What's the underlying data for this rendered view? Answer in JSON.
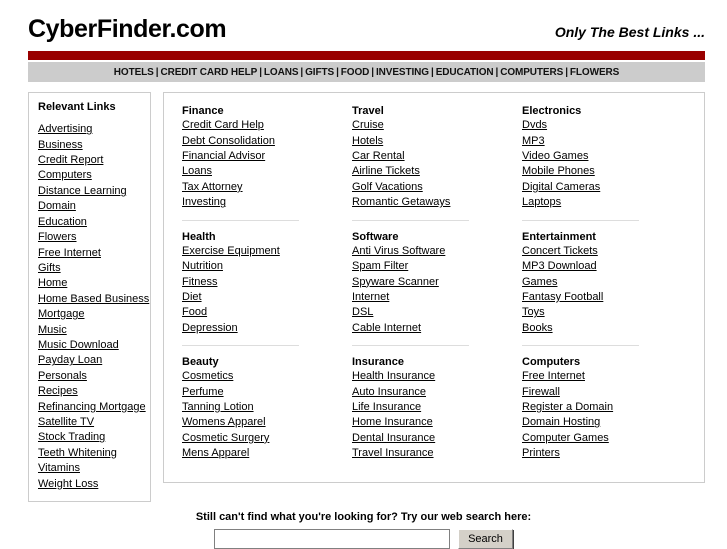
{
  "header": {
    "logo": "CyberFinder.com",
    "tagline": "Only The Best Links ..."
  },
  "topnav": {
    "separator": "|",
    "items": [
      {
        "label": "HOTELS"
      },
      {
        "label": "CREDIT CARD HELP"
      },
      {
        "label": "LOANS"
      },
      {
        "label": "GIFTS"
      },
      {
        "label": "FOOD"
      },
      {
        "label": "INVESTING"
      },
      {
        "label": "EDUCATION"
      },
      {
        "label": "COMPUTERS"
      },
      {
        "label": "FLOWERS"
      }
    ]
  },
  "sidebar": {
    "title": "Relevant Links",
    "items": [
      {
        "label": "Advertising"
      },
      {
        "label": "Business"
      },
      {
        "label": "Credit Report"
      },
      {
        "label": "Computers"
      },
      {
        "label": "Distance Learning"
      },
      {
        "label": "Domain"
      },
      {
        "label": "Education"
      },
      {
        "label": "Flowers"
      },
      {
        "label": "Free Internet"
      },
      {
        "label": "Gifts"
      },
      {
        "label": "Home"
      },
      {
        "label": "Home Based Business"
      },
      {
        "label": "Mortgage"
      },
      {
        "label": "Music"
      },
      {
        "label": "Music Download"
      },
      {
        "label": "Payday Loan"
      },
      {
        "label": "Personals"
      },
      {
        "label": "Recipes"
      },
      {
        "label": "Refinancing Mortgage"
      },
      {
        "label": "Satellite TV"
      },
      {
        "label": "Stock Trading"
      },
      {
        "label": "Teeth Whitening"
      },
      {
        "label": "Vitamins"
      },
      {
        "label": "Weight Loss"
      }
    ]
  },
  "main": {
    "columns": [
      {
        "groups": [
          {
            "title": "Finance",
            "links": [
              {
                "label": "Credit Card Help"
              },
              {
                "label": "Debt Consolidation"
              },
              {
                "label": "Financial Advisor"
              },
              {
                "label": "Loans"
              },
              {
                "label": "Tax Attorney"
              },
              {
                "label": "Investing"
              }
            ]
          },
          {
            "title": "Health",
            "links": [
              {
                "label": "Exercise Equipment"
              },
              {
                "label": "Nutrition"
              },
              {
                "label": "Fitness"
              },
              {
                "label": "Diet"
              },
              {
                "label": "Food"
              },
              {
                "label": "Depression"
              }
            ]
          },
          {
            "title": "Beauty",
            "links": [
              {
                "label": "Cosmetics"
              },
              {
                "label": "Perfume"
              },
              {
                "label": "Tanning Lotion"
              },
              {
                "label": "Womens Apparel"
              },
              {
                "label": "Cosmetic Surgery"
              },
              {
                "label": "Mens Apparel"
              }
            ]
          }
        ]
      },
      {
        "groups": [
          {
            "title": "Travel",
            "links": [
              {
                "label": "Cruise"
              },
              {
                "label": "Hotels"
              },
              {
                "label": "Car Rental"
              },
              {
                "label": "Airline Tickets"
              },
              {
                "label": "Golf Vacations"
              },
              {
                "label": "Romantic Getaways"
              }
            ]
          },
          {
            "title": "Software",
            "links": [
              {
                "label": "Anti Virus Software"
              },
              {
                "label": "Spam Filter"
              },
              {
                "label": "Spyware Scanner"
              },
              {
                "label": "Internet"
              },
              {
                "label": "DSL"
              },
              {
                "label": "Cable Internet"
              }
            ]
          },
          {
            "title": "Insurance",
            "links": [
              {
                "label": "Health Insurance"
              },
              {
                "label": "Auto Insurance"
              },
              {
                "label": "Life Insurance"
              },
              {
                "label": "Home Insurance"
              },
              {
                "label": "Dental Insurance"
              },
              {
                "label": "Travel Insurance"
              }
            ]
          }
        ]
      },
      {
        "groups": [
          {
            "title": "Electronics",
            "links": [
              {
                "label": "Dvds"
              },
              {
                "label": "MP3"
              },
              {
                "label": "Video Games"
              },
              {
                "label": "Mobile Phones"
              },
              {
                "label": "Digital Cameras"
              },
              {
                "label": "Laptops"
              }
            ]
          },
          {
            "title": "Entertainment",
            "links": [
              {
                "label": "Concert Tickets"
              },
              {
                "label": "MP3 Download"
              },
              {
                "label": "Games"
              },
              {
                "label": "Fantasy Football"
              },
              {
                "label": "Toys"
              },
              {
                "label": "Books"
              }
            ]
          },
          {
            "title": "Computers",
            "links": [
              {
                "label": "Free Internet"
              },
              {
                "label": "Firewall"
              },
              {
                "label": "Register a Domain"
              },
              {
                "label": "Domain Hosting"
              },
              {
                "label": "Computer Games"
              },
              {
                "label": "Printers"
              }
            ]
          }
        ]
      }
    ]
  },
  "search": {
    "prompt": "Still can't find what you're looking for? Try our web search here:",
    "value": "",
    "placeholder": "",
    "button_label": "Search"
  },
  "colors": {
    "accent_red": "#990000",
    "nav_gray": "#cccccc",
    "panel_border": "#cccccc",
    "separator": "#dddddd",
    "button_face": "#d4d0c8"
  }
}
